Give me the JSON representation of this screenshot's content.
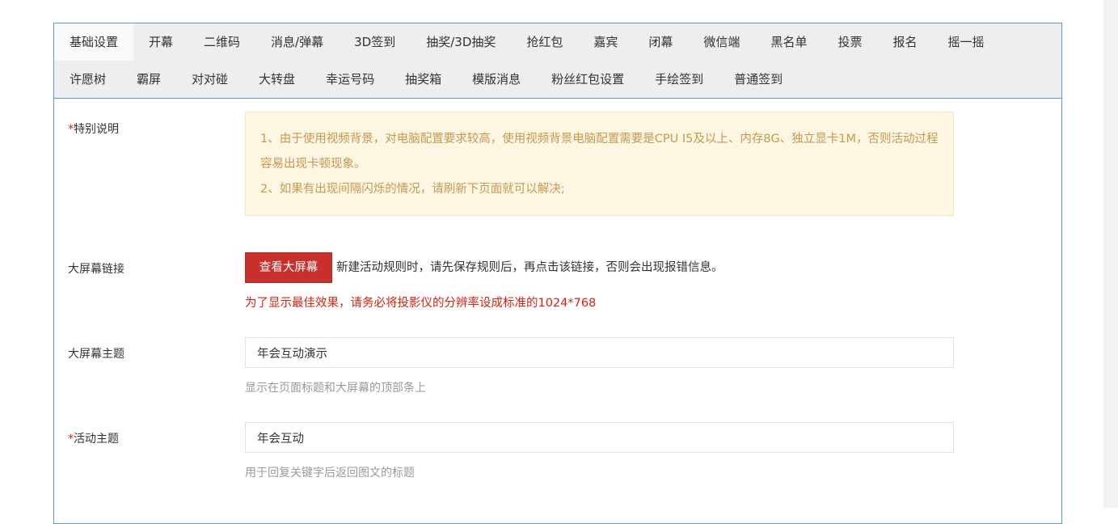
{
  "tabs": {
    "row1": [
      "基础设置",
      "开幕",
      "二维码",
      "消息/弹幕",
      "3D签到",
      "抽奖/3D抽奖",
      "抢红包",
      "嘉宾",
      "闭幕",
      "微信端",
      "黑名单",
      "投票",
      "报名",
      "摇一摇"
    ],
    "row2": [
      "许愿树",
      "霸屏",
      "对对碰",
      "大转盘",
      "幸运号码",
      "抽奖箱",
      "模版消息",
      "粉丝红包设置",
      "手绘签到",
      "普通签到"
    ],
    "active": "基础设置"
  },
  "special_note": {
    "required_mark": "*",
    "label": "特别说明",
    "line1": "1、由于使用视频背景，对电脑配置要求较高，使用视频背景电脑配置需要是CPU I5及以上、内存8G、独立显卡1M，否则活动过程容易出现卡顿现象。",
    "line2": "2、如果有出现间隔闪烁的情况，请刷新下页面就可以解决;"
  },
  "screen_link": {
    "label": "大屏幕链接",
    "button": "查看大屏幕",
    "hint": "新建活动规则时，请先保存规则后，再点击该链接，否则会出现报错信息。",
    "warning": "为了显示最佳效果，请务必将投影仪的分辨率设成标准的1024*768"
  },
  "screen_theme": {
    "label": "大屏幕主题",
    "value": "年会互动演示",
    "help": "显示在页面标题和大屏幕的顶部条上"
  },
  "activity_theme": {
    "required_mark": "*",
    "label": "活动主题",
    "value": "年会互动",
    "help": "用于回复关键字后返回图文的标题"
  },
  "colors": {
    "accent_border": "#5b9bd5",
    "danger": "#c9302c",
    "notice_bg": "#fdf6e3",
    "notice_text": "#c69a4c",
    "required": "#d9230f"
  }
}
